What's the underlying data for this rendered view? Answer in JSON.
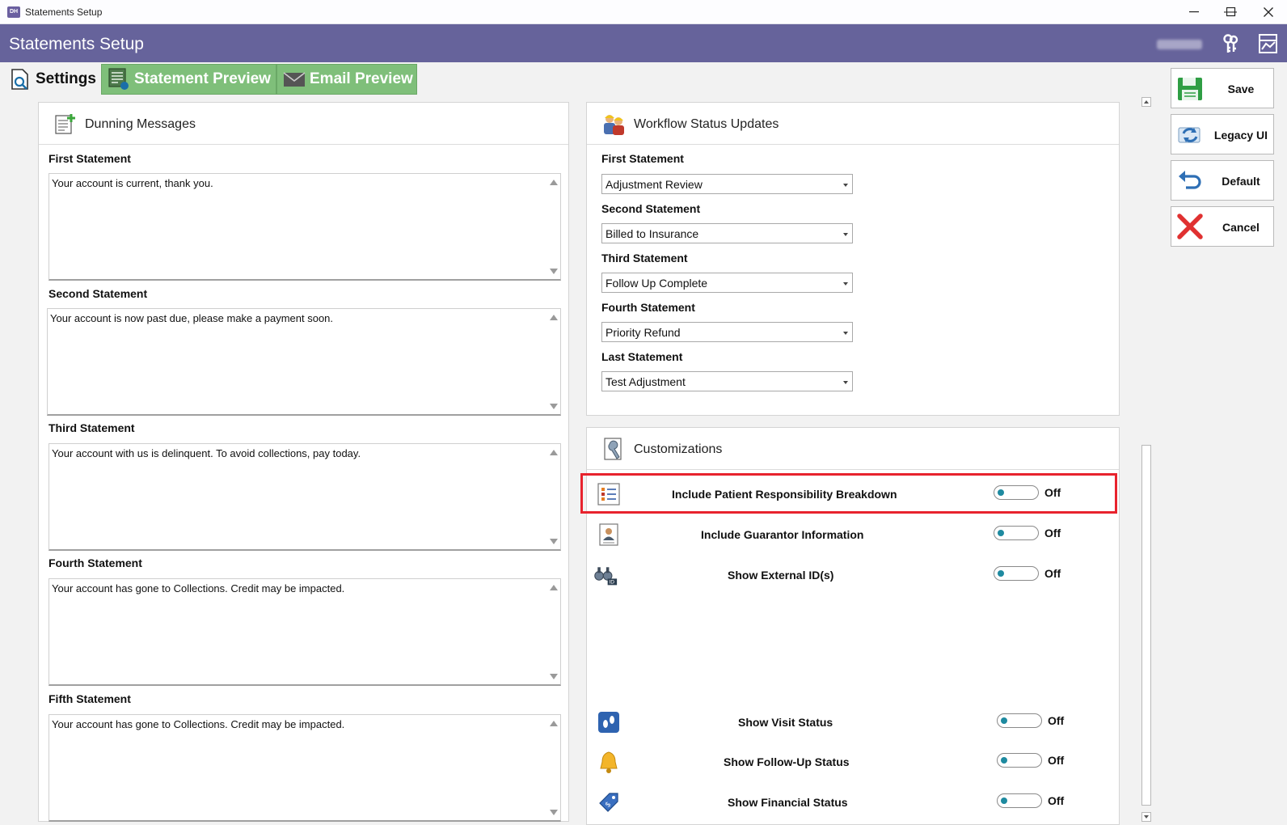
{
  "window": {
    "title": "Statements Setup",
    "minimize": "—",
    "maximize": "☐",
    "close": "✕"
  },
  "header": {
    "title": "Statements Setup"
  },
  "tabs": {
    "settings": "Settings",
    "statement_preview": "Statement Preview",
    "email_preview": "Email Preview"
  },
  "dunning": {
    "title": "Dunning Messages",
    "items": [
      {
        "label": "First Statement",
        "value": "Your account is current, thank you."
      },
      {
        "label": "Second Statement",
        "value": "Your account is now past due, please make a payment soon."
      },
      {
        "label": "Third Statement",
        "value": "Your account with us is delinquent. To avoid collections, pay today."
      },
      {
        "label": "Fourth Statement",
        "value": "Your account has gone to Collections. Credit may be impacted."
      },
      {
        "label": "Fifth Statement",
        "value": "Your account has gone to Collections. Credit may be impacted."
      }
    ]
  },
  "workflow": {
    "title": "Workflow Status Updates",
    "items": [
      {
        "label": "First Statement",
        "value": "Adjustment Review"
      },
      {
        "label": "Second Statement",
        "value": "Billed to Insurance"
      },
      {
        "label": "Third Statement",
        "value": "Follow Up Complete"
      },
      {
        "label": "Fourth Statement",
        "value": "Priority Refund"
      },
      {
        "label": "Last Statement",
        "value": "Test Adjustment"
      }
    ]
  },
  "customizations": {
    "title": "Customizations",
    "items": [
      {
        "label": "Include Patient Responsibility Breakdown",
        "state": "Off",
        "icon": "list-icon"
      },
      {
        "label": "Include Guarantor Information",
        "state": "Off",
        "icon": "id-card-icon"
      },
      {
        "label": "Show External ID(s)",
        "state": "Off",
        "icon": "binoculars-icon"
      },
      {
        "label": "Show Visit Status",
        "state": "Off",
        "icon": "footprints-icon"
      },
      {
        "label": "Show Follow-Up Status",
        "state": "Off",
        "icon": "bell-icon"
      },
      {
        "label": "Show Financial Status",
        "state": "Off",
        "icon": "price-tag-icon"
      }
    ]
  },
  "actions": {
    "save": "Save",
    "legacy": "Legacy UI",
    "default": "Default",
    "cancel": "Cancel"
  },
  "colors": {
    "header": "#66639b",
    "tab_green": "#7fbf7a",
    "highlight": "#e8232d",
    "toggle_knob": "#1e8aa0"
  }
}
